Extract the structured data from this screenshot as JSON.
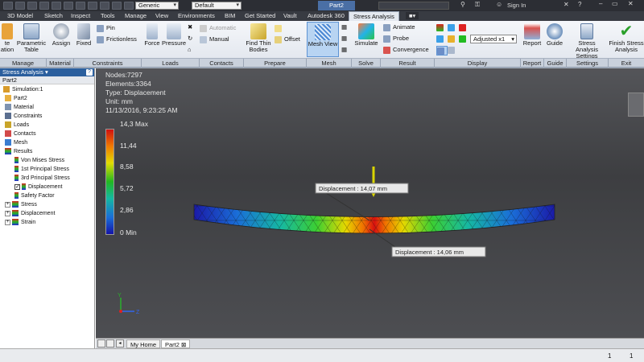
{
  "titlebar": {
    "material_combo": "Generic",
    "appearance_combo": "Default",
    "document_title": "Part2",
    "signin": "Sign In"
  },
  "tabs": [
    "3D Model",
    "Sketch",
    "Inspect",
    "Tools",
    "Manage",
    "View",
    "Environments",
    "BIM",
    "Get Started",
    "Vault",
    "Autodesk 360",
    "Stress Analysis"
  ],
  "ribbon": {
    "parametric_table": "Parametric Table",
    "assign": "Assign",
    "fixed": "Fixed",
    "pin": "Pin",
    "frictionless": "Frictionless",
    "force": "Force",
    "pressure": "Pressure",
    "automatic": "Automatic",
    "manual": "Manual",
    "find_thin_bodies": "Find Thin Bodies",
    "offset": "Offset",
    "mesh_view": "Mesh View",
    "simulate": "Simulate",
    "animate": "Animate",
    "probe": "Probe",
    "convergence": "Convergence",
    "display_combo": "Adjusted x1",
    "report": "Report",
    "guide": "Guide",
    "stress_settings": "Stress Analysis Settings",
    "finish": "Finish Stress Analysis",
    "groups": [
      "Manage",
      "Material",
      "Constraints",
      "Loads",
      "Contacts",
      "Prepare",
      "Mesh",
      "Solve",
      "Result",
      "Display",
      "Report",
      "Guide",
      "Settings",
      "Exit"
    ]
  },
  "browser": {
    "header": "Stress Analysis",
    "subheader": "Part2",
    "items": [
      "Simulation:1",
      "Part2",
      "Material",
      "Constraints",
      "Loads",
      "Contacts",
      "Mesh",
      "Results",
      "Von Mises Stress",
      "1st Principal Stress",
      "3rd Principal Stress",
      "Displacement",
      "Safety Factor",
      "Stress",
      "Displacement",
      "Strain"
    ]
  },
  "viewport": {
    "nodes": "Nodes:7297",
    "elements": "Elements:3364",
    "type": "Type: Displacement",
    "unit": "Unit: mm",
    "timestamp": "11/13/2016, 9:23:25 AM",
    "legend": [
      "14,3 Max",
      "11,44",
      "8,58",
      "5,72",
      "2,86",
      "0 Min"
    ],
    "probe_top": "Displacement : 14,07 mm",
    "probe_bottom": "Displacement : 14,06 mm",
    "axis_y": "Y",
    "axis_z": "Z"
  },
  "doc_tabs": [
    "My Home",
    "Part2"
  ],
  "status": {
    "left": "1",
    "right": "1"
  },
  "colors": {
    "ribbon_active": "#2b5f9e",
    "viewport_bg": "#46474b"
  }
}
